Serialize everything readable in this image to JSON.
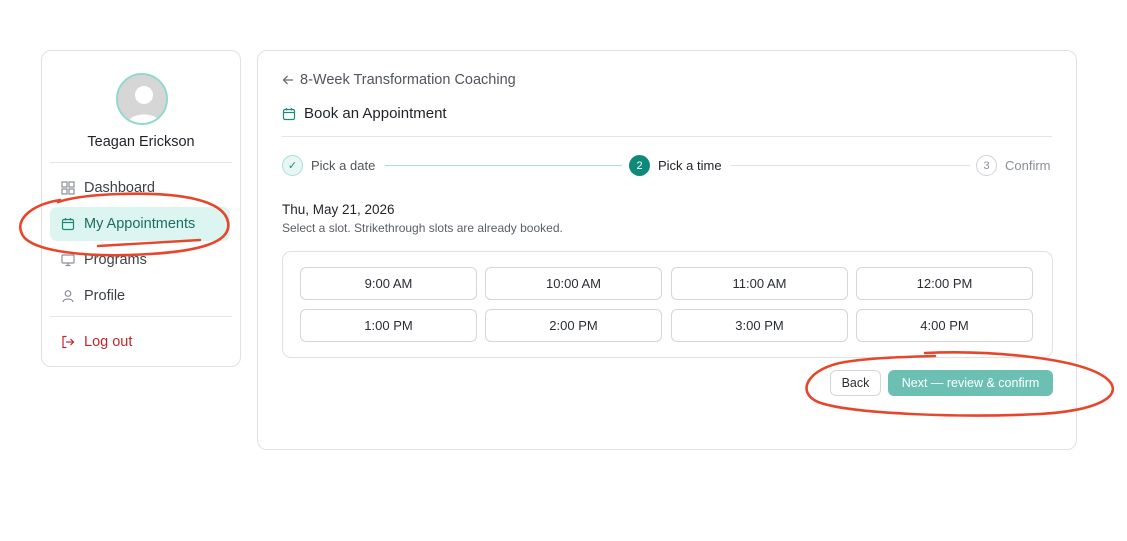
{
  "user": {
    "name": "Teagan Erickson"
  },
  "sidebar": {
    "items": [
      {
        "label": "Dashboard",
        "icon": "grid-icon"
      },
      {
        "label": "My Appointments",
        "icon": "calendar-icon",
        "active": true
      },
      {
        "label": "Programs",
        "icon": "monitor-icon"
      },
      {
        "label": "Profile",
        "icon": "user-icon"
      }
    ],
    "logout": {
      "label": "Log out",
      "icon": "logout-icon"
    }
  },
  "main": {
    "back_label": "8-Week Transformation Coaching",
    "title": "Book an Appointment",
    "steps": [
      {
        "number": "✓",
        "label": "Pick a date",
        "state": "done"
      },
      {
        "number": "2",
        "label": "Pick a time",
        "state": "active"
      },
      {
        "number": "3",
        "label": "Confirm",
        "state": "todo"
      }
    ],
    "date": "Thu, May 21, 2026",
    "hint": "Select a slot. Strikethrough slots are already booked.",
    "slots": [
      "9:00 AM",
      "10:00 AM",
      "11:00 AM",
      "12:00 PM",
      "1:00 PM",
      "2:00 PM",
      "3:00 PM",
      "4:00 PM"
    ],
    "back_button": "Back",
    "next_button": "Next — review & confirm"
  },
  "colors": {
    "accent": "#0f8a7a",
    "accent_light": "#dcf5f0",
    "next_button": "#6cc0b3",
    "logout": "#c0262d",
    "annotation": "#e8462a"
  }
}
